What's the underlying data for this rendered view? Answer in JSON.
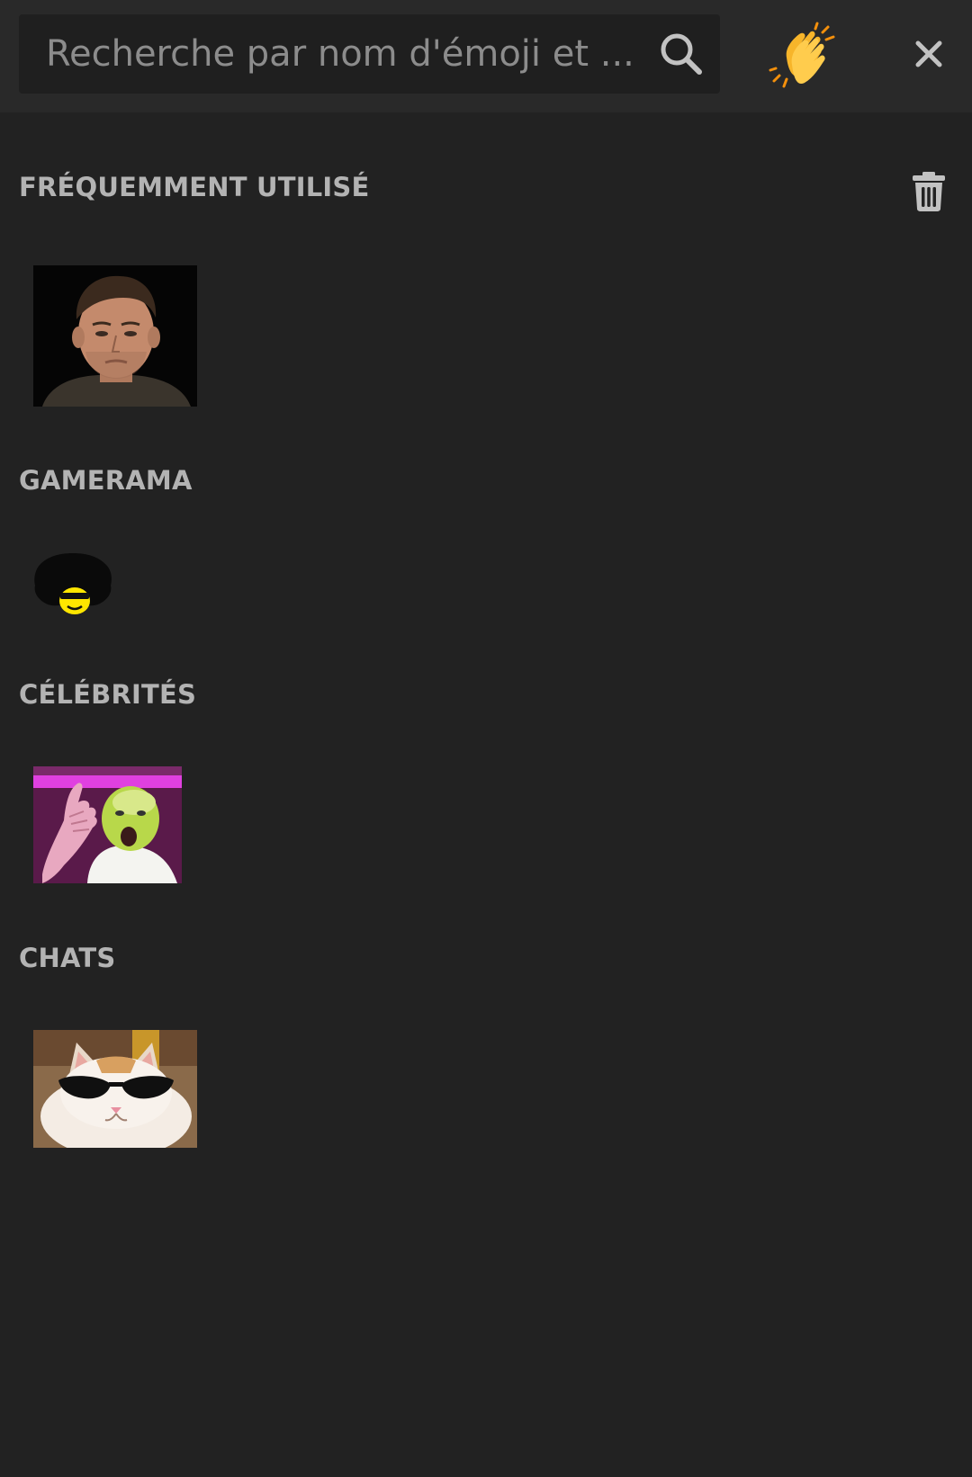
{
  "search": {
    "placeholder": "Recherche par nom d'émoji et ...",
    "value": ""
  },
  "header": {
    "search_icon": "search-icon",
    "skin_tone_emoji": "clapping-hands-emoji",
    "close_icon": "close-icon"
  },
  "sections": [
    {
      "title": "FRÉQUEMMENT UTILISÉ",
      "action_icon": "trash-icon",
      "items": [
        "custom-emoji-man-sad"
      ]
    },
    {
      "title": "GAMERAMA",
      "items": [
        "custom-emoji-afro-sunglasses"
      ]
    },
    {
      "title": "CÉLÉBRITÉS",
      "items": [
        "custom-emoji-dancing-man"
      ]
    },
    {
      "title": "CHATS",
      "items": [
        "custom-emoji-cat-sunglasses"
      ]
    }
  ],
  "colors": {
    "background": "#222222",
    "header_background": "#292929",
    "search_background": "#1f1f1f",
    "section_title": "#b3b3b3",
    "icon": "#c2c2c2"
  }
}
